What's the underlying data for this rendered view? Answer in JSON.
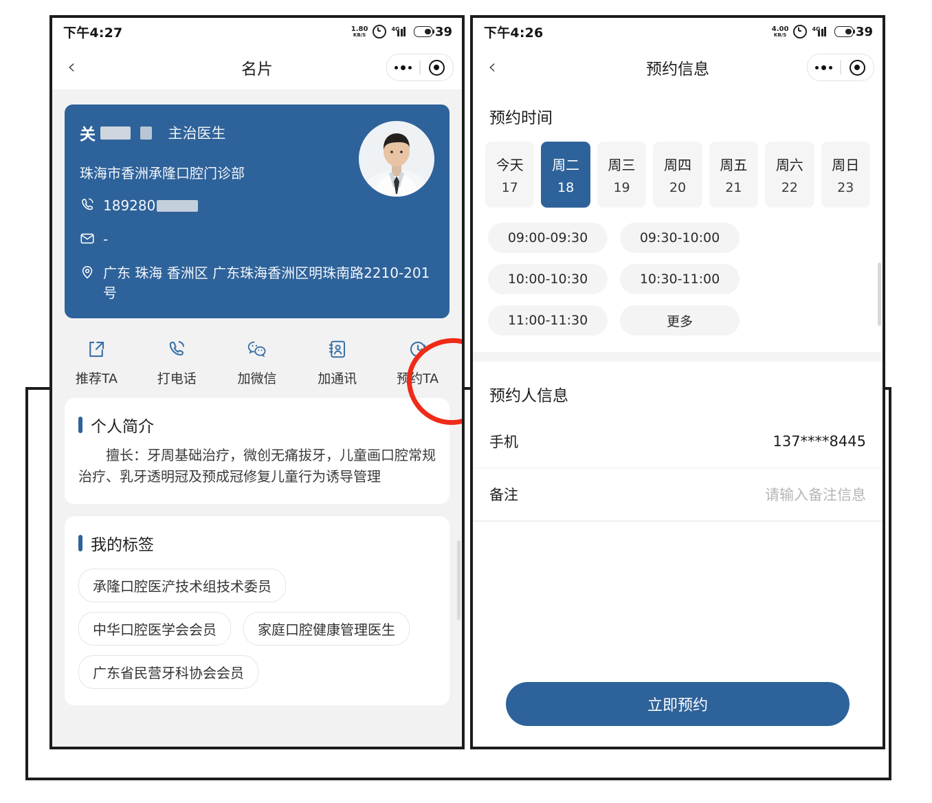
{
  "left_screen": {
    "status_bar": {
      "time": "下午4:27",
      "net_speed_value": "1.80",
      "net_speed_unit": "KB/S",
      "network_type": "4G",
      "battery_percent": "39"
    },
    "nav": {
      "title": "名片",
      "back_icon": "chevron-left-icon"
    },
    "card": {
      "name": "关",
      "title": "主治医生",
      "org": "珠海市香洲承隆口腔门诊部",
      "phone": "189280",
      "email": "-",
      "address": "广东 珠海 香洲区 广东珠海香洲区明珠南路2210-201号"
    },
    "actions": [
      {
        "icon": "share-icon",
        "label": "推荐TA"
      },
      {
        "icon": "phone-icon",
        "label": "打电话"
      },
      {
        "icon": "wechat-icon",
        "label": "加微信"
      },
      {
        "icon": "contacts-icon",
        "label": "加通讯"
      },
      {
        "icon": "clock-icon",
        "label": "预约TA"
      }
    ],
    "intro": {
      "heading": "个人简介",
      "text": "擅长：牙周基础治疗，微创无痛拔牙，儿童画口腔常规治疗、乳牙透明冠及预成冠修复儿童行为诱导管理"
    },
    "tags": {
      "heading": "我的标签",
      "items": [
        "承隆口腔医浐技术组技术委员",
        "中华口腔医学会会员",
        "家庭口腔健康管理医生",
        "广东省民营牙科协会会员"
      ]
    },
    "annotation": {
      "type": "red-circle",
      "targets": "预约TA"
    }
  },
  "right_screen": {
    "status_bar": {
      "time": "下午4:26",
      "net_speed_value": "4.00",
      "net_speed_unit": "KB/S",
      "network_type": "4G",
      "battery_percent": "39"
    },
    "nav": {
      "title": "预约信息",
      "back_icon": "chevron-left-icon"
    },
    "appointment_time": {
      "heading": "预约时间",
      "dates": [
        {
          "weekday": "今天",
          "day": "17",
          "selected": false
        },
        {
          "weekday": "周二",
          "day": "18",
          "selected": true
        },
        {
          "weekday": "周三",
          "day": "19",
          "selected": false
        },
        {
          "weekday": "周四",
          "day": "20",
          "selected": false
        },
        {
          "weekday": "周五",
          "day": "21",
          "selected": false
        },
        {
          "weekday": "周六",
          "day": "22",
          "selected": false
        },
        {
          "weekday": "周日",
          "day": "23",
          "selected": false
        }
      ],
      "slots": [
        "09:00-09:30",
        "09:30-10:00",
        "10:00-10:30",
        "10:30-11:00",
        "11:00-11:30",
        "更多"
      ]
    },
    "booker_info": {
      "heading": "预约人信息",
      "rows": [
        {
          "label": "手机",
          "value": "137****8445",
          "is_placeholder": false
        },
        {
          "label": "备注",
          "value": "请输入备注信息",
          "is_placeholder": true
        }
      ]
    },
    "submit_label": "立即预约"
  },
  "colors": {
    "brand_blue": "#2e629a",
    "annotation_red": "#ef2b18",
    "page_gray": "#f2f2f2",
    "chip_gray": "#f4f4f4"
  }
}
